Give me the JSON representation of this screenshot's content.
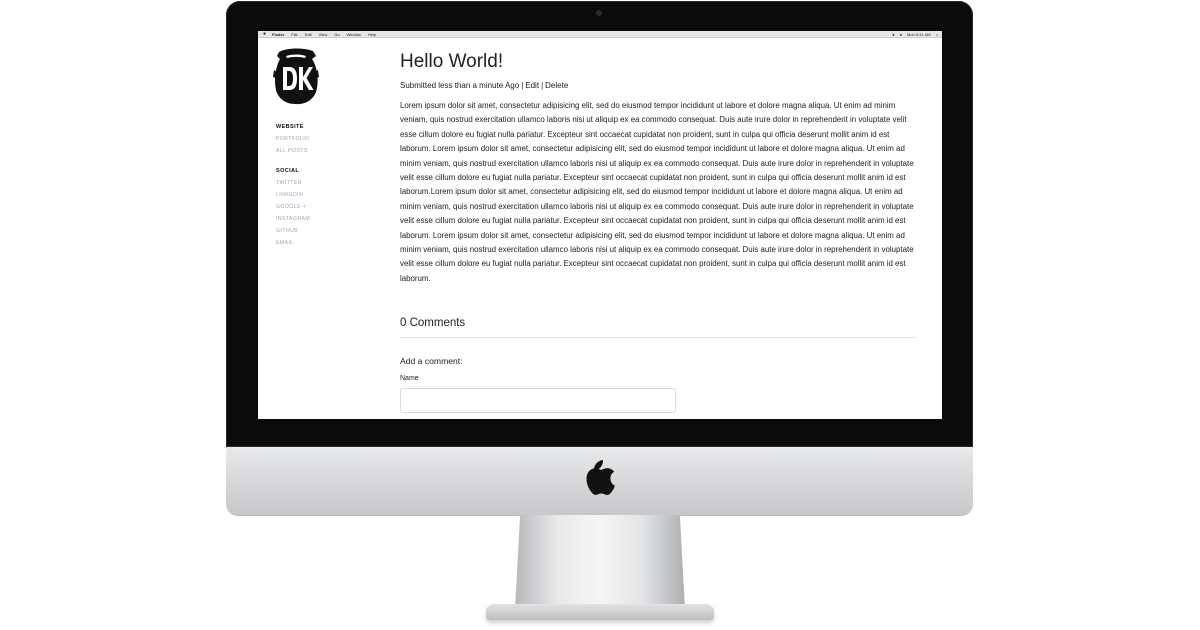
{
  "menubar": {
    "app": "Finder",
    "items": [
      "File",
      "Edit",
      "View",
      "Go",
      "Window",
      "Help"
    ],
    "clock": "Mon 9:41 AM"
  },
  "sidebar": {
    "sections": [
      {
        "heading": "WEBSITE",
        "links": [
          "PORTFOLIO",
          "ALL POSTS"
        ]
      },
      {
        "heading": "SOCIAL",
        "links": [
          "TWITTER",
          "LINKEDIN",
          "GOOGLE +",
          "INSTAGRAM",
          "GITHUB",
          "EMAIL"
        ]
      }
    ]
  },
  "post": {
    "title": "Hello World!",
    "submitted": "Submitted less than a minute Ago",
    "edit": "Edit",
    "delete": "Delete",
    "separator": "|",
    "body": "Lorem ipsum dolor sit amet, consectetur adipisicing elit, sed do eiusmod tempor incididunt ut labore et dolore magna aliqua. Ut enim ad minim veniam, quis nostrud exercitation ullamco laboris nisi ut aliquip ex ea commodo consequat. Duis aute irure dolor in reprehenderit in voluptate velit esse cillum dolore eu fugiat nulla pariatur. Excepteur sint occaecat cupidatat non proident, sunt in culpa qui officia deserunt mollit anim id est laborum. Lorem ipsum dolor sit amet, consectetur adipisicing elit, sed do eiusmod tempor incididunt ut labore et dolore magna aliqua. Ut enim ad minim veniam, quis nostrud exercitation ullamco laboris nisi ut aliquip ex ea commodo consequat. Duis aute irure dolor in reprehenderit in voluptate velit esse cillum dolore eu fugiat nulla pariatur. Excepteur sint occaecat cupidatat non proident, sunt in culpa qui officia deserunt mollit anim id est laborum.Lorem ipsum dolor sit amet, consectetur adipisicing elit, sed do eiusmod tempor incididunt ut labore et dolore magna aliqua. Ut enim ad minim veniam, quis nostrud exercitation ullamco laboris nisi ut aliquip ex ea commodo consequat. Duis aute irure dolor in reprehenderit in voluptate velit esse cillum dolore eu fugiat nulla pariatur. Excepteur sint occaecat cupidatat non proident, sunt in culpa qui officia deserunt mollit anim id est laborum. Lorem ipsum dolor sit amet, consectetur adipisicing elit, sed do eiusmod tempor incididunt ut labore et dolore magna aliqua. Ut enim ad minim veniam, quis nostrud exercitation ullamco laboris nisi ut aliquip ex ea commodo consequat. Duis aute irure dolor in reprehenderit in voluptate velit esse cillum dolore eu fugiat nulla pariatur. Excepteur sint occaecat cupidatat non proident, sunt in culpa qui officia deserunt mollit anim id est laborum."
  },
  "comments": {
    "title": "0 Comments",
    "add_label": "Add a comment:",
    "name_label": "Name",
    "name_value": ""
  },
  "colors": {
    "nav_link": "#9aa7b4",
    "text": "#222222",
    "bezel": "#0b0b0b"
  },
  "icons": {
    "logo": "dk-logo-icon",
    "hardware": "apple-logo-icon"
  }
}
